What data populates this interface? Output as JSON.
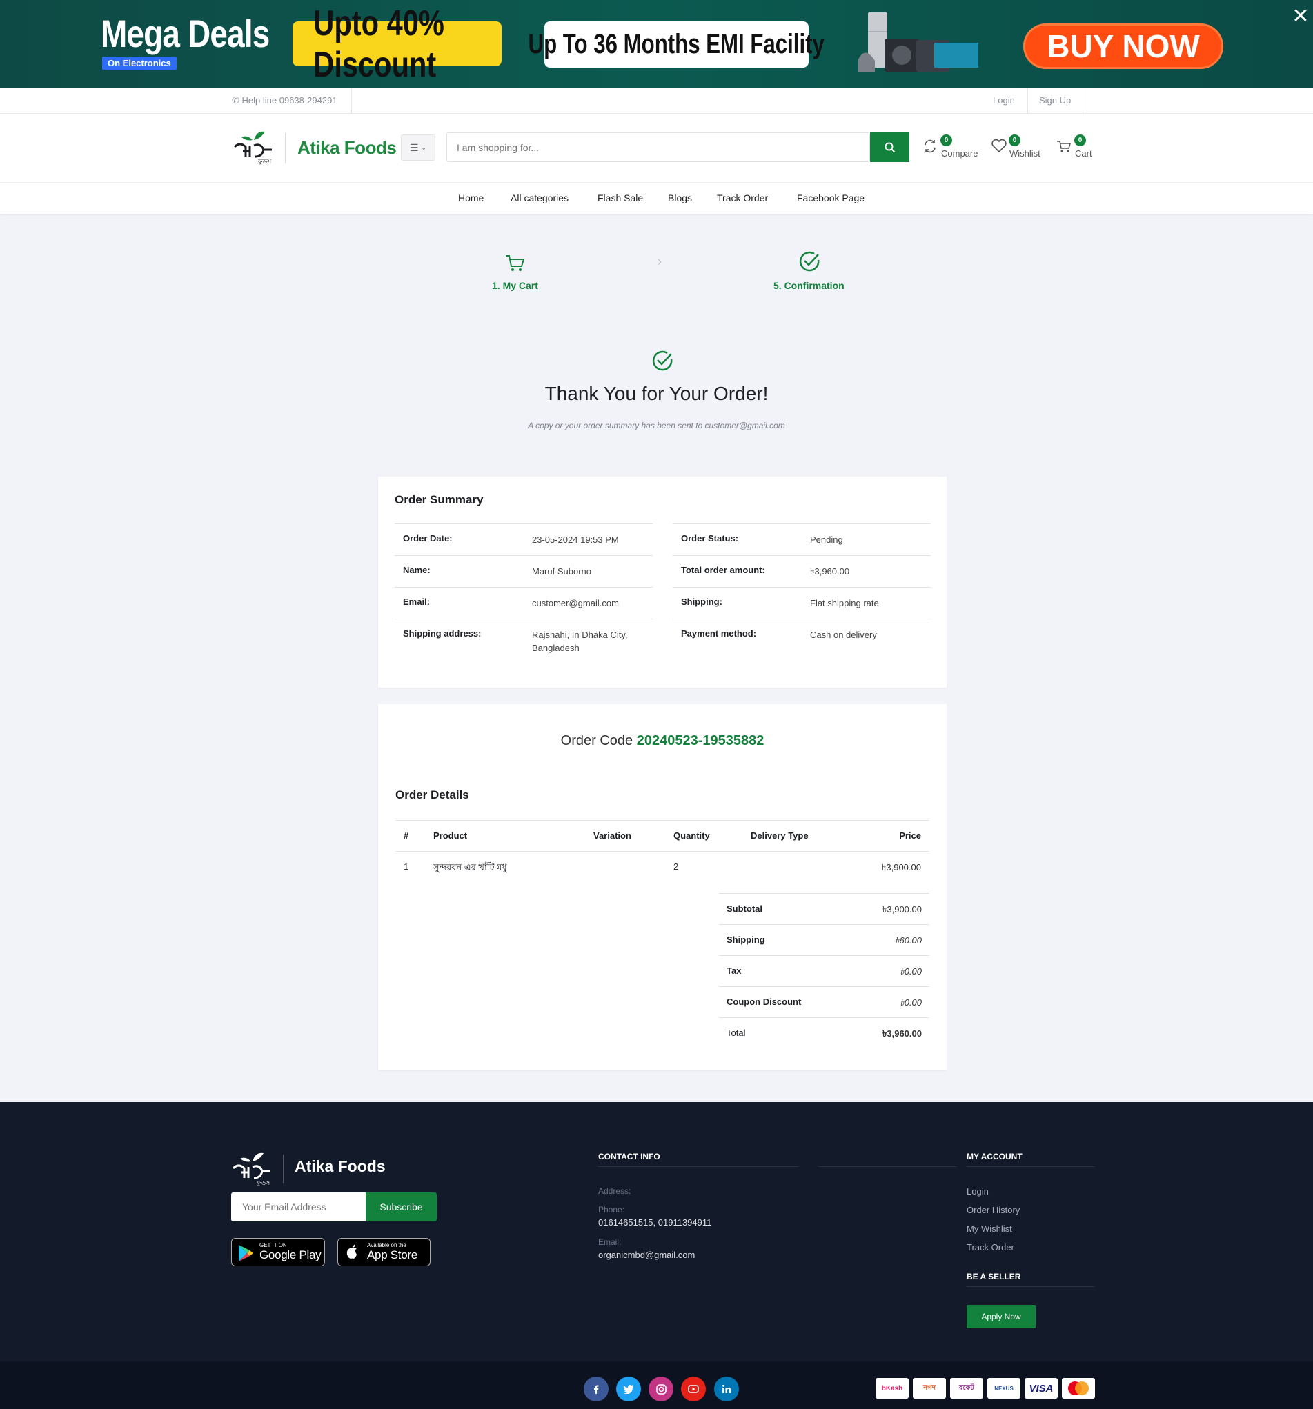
{
  "banner": {
    "title": "Mega Deals",
    "subtitle": "On Electronics",
    "discount": "Upto 40% Discount",
    "emi": "Up To 36 Months EMI Facility",
    "cta": "BUY NOW"
  },
  "topbar": {
    "helpline": "Help line 09638-294291",
    "login": "Login",
    "signup": "Sign Up"
  },
  "header": {
    "brand": "Atika Foods",
    "search_placeholder": "I am shopping for...",
    "compare": {
      "label": "Compare",
      "count": "0"
    },
    "wishlist": {
      "label": "Wishlist",
      "count": "0"
    },
    "cart": {
      "label": "Cart",
      "count": "0"
    }
  },
  "nav": [
    "Home",
    "All categories",
    "Flash Sale",
    "Blogs",
    "Track Order",
    "Facebook Page"
  ],
  "steps": {
    "step1": "1. My Cart",
    "step2": "5. Confirmation"
  },
  "thanks": {
    "title": "Thank You for Your Order!",
    "subtitle": "A copy or your order summary has been sent to customer@gmail.com"
  },
  "summary": {
    "title": "Order Summary",
    "left": [
      {
        "k": "Order Date:",
        "v": "23-05-2024 19:53 PM"
      },
      {
        "k": "Name:",
        "v": "Maruf Suborno"
      },
      {
        "k": "Email:",
        "v": "customer@gmail.com"
      },
      {
        "k": "Shipping address:",
        "v": "Rajshahi, In Dhaka City, Bangladesh"
      }
    ],
    "right": [
      {
        "k": "Order Status:",
        "v": "Pending"
      },
      {
        "k": "Total order amount:",
        "v": "৳3,960.00"
      },
      {
        "k": "Shipping:",
        "v": "Flat shipping rate"
      },
      {
        "k": "Payment method:",
        "v": "Cash on delivery"
      }
    ]
  },
  "order": {
    "code_label": "Order Code",
    "code": "20240523-19535882",
    "details_title": "Order Details",
    "columns": [
      "#",
      "Product",
      "Variation",
      "Quantity",
      "Delivery Type",
      "Price"
    ],
    "rows": [
      {
        "num": "1",
        "product": "সুন্দরবন এর খাঁটি মধু",
        "variation": "",
        "quantity": "2",
        "delivery": "",
        "price": "৳3,900.00"
      }
    ],
    "totals": [
      {
        "k": "Subtotal",
        "v": "৳3,900.00"
      },
      {
        "k": "Shipping",
        "v": "৳60.00"
      },
      {
        "k": "Tax",
        "v": "৳0.00"
      },
      {
        "k": "Coupon Discount",
        "v": "৳0.00"
      },
      {
        "k": "Total",
        "v": "৳3,960.00"
      }
    ]
  },
  "footer": {
    "brand": "Atika Foods",
    "email_placeholder": "Your Email Address",
    "subscribe": "Subscribe",
    "google_play": {
      "small": "GET IT ON",
      "big": "Google Play"
    },
    "app_store": {
      "small": "Available on the",
      "big": "App Store"
    },
    "contact": {
      "heading": "CONTACT INFO",
      "address_label": "Address:",
      "phone_label": "Phone:",
      "phone": "01614651515, 01911394911",
      "email_label": "Email:",
      "email": "organicmbd@gmail.com"
    },
    "account": {
      "heading": "MY ACCOUNT",
      "links": [
        "Login",
        "Order History",
        "My Wishlist",
        "Track Order"
      ],
      "seller_heading": "BE A SELLER",
      "apply": "Apply Now"
    },
    "social": [
      "facebook-icon",
      "twitter-icon",
      "instagram-icon",
      "youtube-icon",
      "linkedin-icon"
    ],
    "payments": [
      "bKash",
      "Nagad",
      "Rocket",
      "Dutch-Bangla Nexus",
      "VISA",
      "MasterCard"
    ]
  },
  "colors": {
    "brand_green": "#12823c",
    "footer_bg": "#131a2a",
    "banner_bg": "#0b5a50",
    "cta_orange": "#ff4d12"
  }
}
